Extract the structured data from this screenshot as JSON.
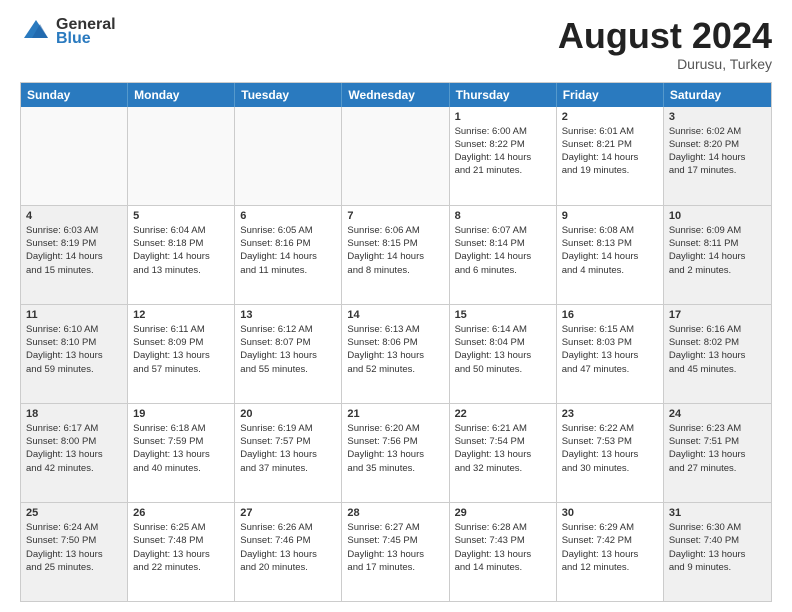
{
  "header": {
    "logo_line1": "General",
    "logo_line2": "Blue",
    "month_title": "August 2024",
    "location": "Durusu, Turkey"
  },
  "days_of_week": [
    "Sunday",
    "Monday",
    "Tuesday",
    "Wednesday",
    "Thursday",
    "Friday",
    "Saturday"
  ],
  "weeks": [
    [
      {
        "day": "",
        "info": "",
        "empty": true
      },
      {
        "day": "",
        "info": "",
        "empty": true
      },
      {
        "day": "",
        "info": "",
        "empty": true
      },
      {
        "day": "",
        "info": "",
        "empty": true
      },
      {
        "day": "1",
        "info": "Sunrise: 6:00 AM\nSunset: 8:22 PM\nDaylight: 14 hours\nand 21 minutes."
      },
      {
        "day": "2",
        "info": "Sunrise: 6:01 AM\nSunset: 8:21 PM\nDaylight: 14 hours\nand 19 minutes."
      },
      {
        "day": "3",
        "info": "Sunrise: 6:02 AM\nSunset: 8:20 PM\nDaylight: 14 hours\nand 17 minutes."
      }
    ],
    [
      {
        "day": "4",
        "info": "Sunrise: 6:03 AM\nSunset: 8:19 PM\nDaylight: 14 hours\nand 15 minutes."
      },
      {
        "day": "5",
        "info": "Sunrise: 6:04 AM\nSunset: 8:18 PM\nDaylight: 14 hours\nand 13 minutes."
      },
      {
        "day": "6",
        "info": "Sunrise: 6:05 AM\nSunset: 8:16 PM\nDaylight: 14 hours\nand 11 minutes."
      },
      {
        "day": "7",
        "info": "Sunrise: 6:06 AM\nSunset: 8:15 PM\nDaylight: 14 hours\nand 8 minutes."
      },
      {
        "day": "8",
        "info": "Sunrise: 6:07 AM\nSunset: 8:14 PM\nDaylight: 14 hours\nand 6 minutes."
      },
      {
        "day": "9",
        "info": "Sunrise: 6:08 AM\nSunset: 8:13 PM\nDaylight: 14 hours\nand 4 minutes."
      },
      {
        "day": "10",
        "info": "Sunrise: 6:09 AM\nSunset: 8:11 PM\nDaylight: 14 hours\nand 2 minutes."
      }
    ],
    [
      {
        "day": "11",
        "info": "Sunrise: 6:10 AM\nSunset: 8:10 PM\nDaylight: 13 hours\nand 59 minutes."
      },
      {
        "day": "12",
        "info": "Sunrise: 6:11 AM\nSunset: 8:09 PM\nDaylight: 13 hours\nand 57 minutes."
      },
      {
        "day": "13",
        "info": "Sunrise: 6:12 AM\nSunset: 8:07 PM\nDaylight: 13 hours\nand 55 minutes."
      },
      {
        "day": "14",
        "info": "Sunrise: 6:13 AM\nSunset: 8:06 PM\nDaylight: 13 hours\nand 52 minutes."
      },
      {
        "day": "15",
        "info": "Sunrise: 6:14 AM\nSunset: 8:04 PM\nDaylight: 13 hours\nand 50 minutes."
      },
      {
        "day": "16",
        "info": "Sunrise: 6:15 AM\nSunset: 8:03 PM\nDaylight: 13 hours\nand 47 minutes."
      },
      {
        "day": "17",
        "info": "Sunrise: 6:16 AM\nSunset: 8:02 PM\nDaylight: 13 hours\nand 45 minutes."
      }
    ],
    [
      {
        "day": "18",
        "info": "Sunrise: 6:17 AM\nSunset: 8:00 PM\nDaylight: 13 hours\nand 42 minutes."
      },
      {
        "day": "19",
        "info": "Sunrise: 6:18 AM\nSunset: 7:59 PM\nDaylight: 13 hours\nand 40 minutes."
      },
      {
        "day": "20",
        "info": "Sunrise: 6:19 AM\nSunset: 7:57 PM\nDaylight: 13 hours\nand 37 minutes."
      },
      {
        "day": "21",
        "info": "Sunrise: 6:20 AM\nSunset: 7:56 PM\nDaylight: 13 hours\nand 35 minutes."
      },
      {
        "day": "22",
        "info": "Sunrise: 6:21 AM\nSunset: 7:54 PM\nDaylight: 13 hours\nand 32 minutes."
      },
      {
        "day": "23",
        "info": "Sunrise: 6:22 AM\nSunset: 7:53 PM\nDaylight: 13 hours\nand 30 minutes."
      },
      {
        "day": "24",
        "info": "Sunrise: 6:23 AM\nSunset: 7:51 PM\nDaylight: 13 hours\nand 27 minutes."
      }
    ],
    [
      {
        "day": "25",
        "info": "Sunrise: 6:24 AM\nSunset: 7:50 PM\nDaylight: 13 hours\nand 25 minutes."
      },
      {
        "day": "26",
        "info": "Sunrise: 6:25 AM\nSunset: 7:48 PM\nDaylight: 13 hours\nand 22 minutes."
      },
      {
        "day": "27",
        "info": "Sunrise: 6:26 AM\nSunset: 7:46 PM\nDaylight: 13 hours\nand 20 minutes."
      },
      {
        "day": "28",
        "info": "Sunrise: 6:27 AM\nSunset: 7:45 PM\nDaylight: 13 hours\nand 17 minutes."
      },
      {
        "day": "29",
        "info": "Sunrise: 6:28 AM\nSunset: 7:43 PM\nDaylight: 13 hours\nand 14 minutes."
      },
      {
        "day": "30",
        "info": "Sunrise: 6:29 AM\nSunset: 7:42 PM\nDaylight: 13 hours\nand 12 minutes."
      },
      {
        "day": "31",
        "info": "Sunrise: 6:30 AM\nSunset: 7:40 PM\nDaylight: 13 hours\nand 9 minutes."
      }
    ]
  ]
}
